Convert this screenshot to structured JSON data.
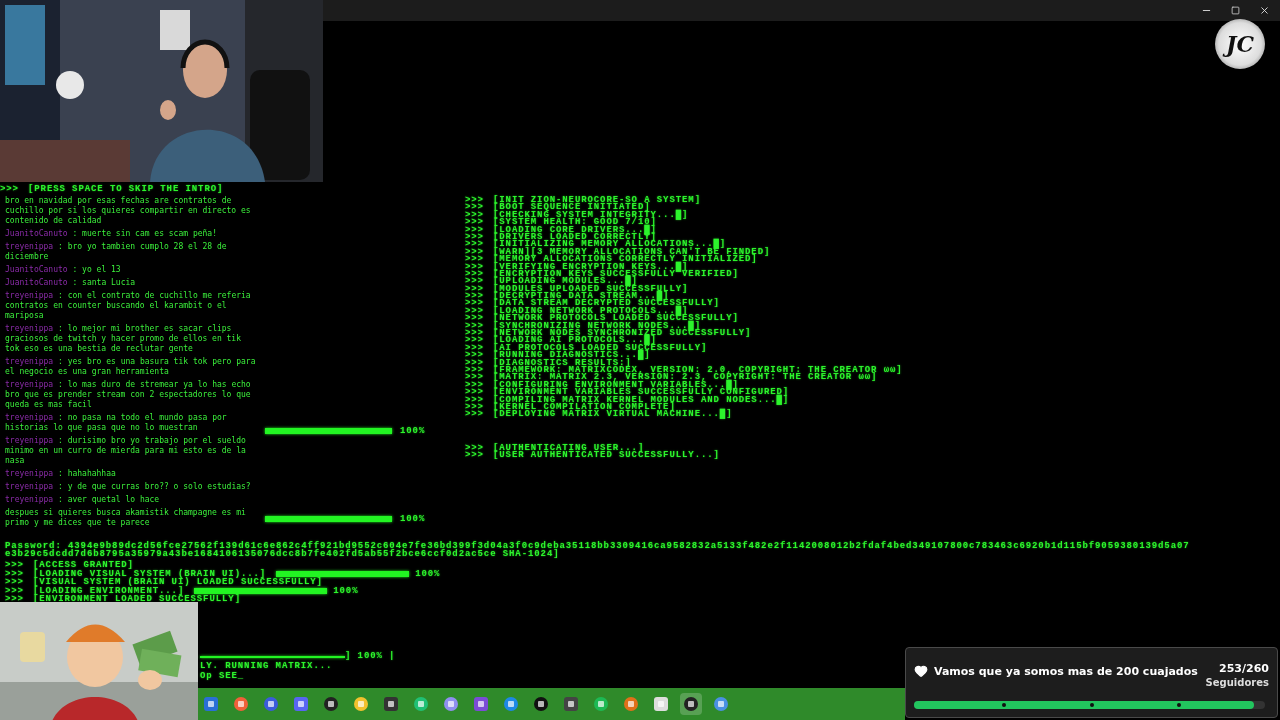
{
  "channel_logo": "JC",
  "terminal": {
    "intro_hint": {
      "prompt": ">>>",
      "text": "[PRESS SPACE TO SKIP THE INTRO]"
    },
    "side_progress": [
      {
        "level": 1,
        "percent": "100%"
      },
      {
        "level": 1,
        "percent": "100%"
      }
    ],
    "boot_log": [
      {
        "prompt": ">>>",
        "text": "[INIT ZION-NEUROCORE-SO A SYSTEM]"
      },
      {
        "prompt": ">>>",
        "text": "[BOOT SEQUENCE INITIATED]"
      },
      {
        "prompt": ">>>",
        "text": "[CHECKING SYSTEM INTEGRITY...█]"
      },
      {
        "prompt": ">>>",
        "text": "[SYSTEM HEALTH: GOOD 7/10]"
      },
      {
        "prompt": ">>>",
        "text": "[LOADING CORE DRIVERS...█]"
      },
      {
        "prompt": ">>>",
        "text": "[DRIVERS LOADED CORRECTLY]"
      },
      {
        "prompt": ">>>",
        "text": "[INITIALIZING MEMORY ALLOCATIONS...█]"
      },
      {
        "prompt": ">>>",
        "text": "[WARN][3 MEMORY ALLOCATIONS CAN'T BE FINDED]"
      },
      {
        "prompt": ">>>",
        "text": "[MEMORY ALLOCATIONS CORRECTLY INITIALIZED]"
      },
      {
        "prompt": ">>>",
        "text": "[VERIFYING ENCRYPTION KEYS...█]"
      },
      {
        "prompt": ">>>",
        "text": "[ENCRYPTION KEYS SUCCESSFULLY VERIFIED]"
      },
      {
        "prompt": ">>>",
        "text": "[UPLOADING MODULES...█]"
      },
      {
        "prompt": ">>>",
        "text": "[MODULES UPLOADED SUCCESSFULLY]"
      },
      {
        "prompt": ">>>",
        "text": "[DECRYPTING DATA STREAM...█]"
      },
      {
        "prompt": ">>>",
        "text": "[DATA STREAM DECRYPTED SUCCESSFULLY]"
      },
      {
        "prompt": ">>>",
        "text": "[LOADING NETWORK PROTOCOLS...█]"
      },
      {
        "prompt": ">>>",
        "text": "[NETWORK PROTOCOLS LOADED SUCCESSFULLY]"
      },
      {
        "prompt": ">>>",
        "text": "[SYNCHRONIZING NETWORK NODES...█]"
      },
      {
        "prompt": ">>>",
        "text": "[NETWORK NODES SYNCHRONIZED SUCCESSFULLY]"
      },
      {
        "prompt": ">>>",
        "text": "[LOADING AI PROTOCOLS...█]"
      },
      {
        "prompt": ">>>",
        "text": "[AI PROTOCOLS LOADED SUCCESSFULLY]"
      },
      {
        "prompt": ">>>",
        "text": "[RUNNING DIAGNOSTICS...█]"
      },
      {
        "prompt": ">>>",
        "text": "[DIAGNOSTICS RESULTS:]"
      },
      {
        "prompt": ">>>",
        "text": "[FRAMEWORK: MATRIXCODEX, VERSION: 2.0, COPYRIGHT: THE CREATOR ωω]"
      },
      {
        "prompt": ">>>",
        "text": "[MATRIX: MATRIX 2.3, VERSION: 2.3, COPYRIGHT: THE CREATOR ωω]"
      },
      {
        "prompt": ">>>",
        "text": "[CONFIGURING ENVIRONMENT VARIABLES...█]"
      },
      {
        "prompt": ">>>",
        "text": "[ENVIRONMENT VARIABLES SUCCESSFULLY CONFIGURED]"
      },
      {
        "prompt": ">>>",
        "text": "[COMPILING MATRIX KERNEL MODULES AND NODES...█]"
      },
      {
        "prompt": ">>>",
        "text": "[KERNEL COMPILATION COMPLETE]"
      },
      {
        "prompt": ">>>",
        "text": "[DEPLOYING MATRIX VIRTUAL MACHINE...█]"
      }
    ],
    "auth_log": [
      {
        "prompt": ">>>",
        "text": "[AUTHENTICATING USER...]"
      },
      {
        "prompt": ">>>",
        "text": "[USER AUTHENTICATED SUCCESSFULLY...]"
      }
    ],
    "credentials": [
      "Password: 4394e9b89dc2d56fce27562f139d61c6e862c4ff921bd9552c604e7fe36bd399f3d04a3f0c9deba35118bb3309416ca9582832a5133f482e2f1142008012b2fdaf4bed349107800c783463c6920b1d115bf9059380139d5a07",
      "e3b29c5dcdd7d6b8795a35979a43be1684106135076dcc8b7fe402fd5ab55f2bce6ccf0d2ac5ce SHA-1024]"
    ],
    "access_log": [
      {
        "prompt": ">>>",
        "text": "[ACCESS GRANTED]"
      },
      {
        "prompt": ">>>",
        "text": "[LOADING VISUAL SYSTEM (BRAIN UI)...]",
        "level": 1,
        "percent": "100%"
      },
      {
        "prompt": ">>>",
        "text": "[VISUAL SYSTEM (BRAIN UI) LOADED SUCCESSFULLY]"
      },
      {
        "prompt": ">>>",
        "text": "[LOADING ENVIRONMENT...]",
        "level": 1,
        "percent": "100%"
      },
      {
        "prompt": ">>>",
        "text": "[ENVIRONMENT LOADED SUCCESSFULLY]"
      }
    ],
    "tail": [
      {
        "level": 1,
        "text": "] 100% |"
      },
      {
        "text": "LY. RUNNING MATRIX..."
      },
      {
        "text": "Op SEE_"
      }
    ]
  },
  "chat": [
    {
      "message": "bro en navidad por esas fechas are contratos de cuchillo por si los quieres compartir en directo es contenido de calidad"
    },
    {
      "user": "JuanitoCanuto",
      "sep": ":",
      "message": "muerte sin cam es scam peña!"
    },
    {
      "user": "treyenippa",
      "sep": ":",
      "message": "bro yo tambien cumplo 28 el 28 de diciembre"
    },
    {
      "user": "JuanitoCanuto",
      "sep": ":",
      "message": "yo el 13"
    },
    {
      "user": "JuanitoCanuto",
      "sep": ":",
      "message": "santa Lucia"
    },
    {
      "user": "treyenippa",
      "sep": ":",
      "message": "con el contrato de cuchillo me referia contratos en counter buscando el karambit o el mariposa"
    },
    {
      "user": "treyenippa",
      "sep": ":",
      "message": "lo mejor mi brother es sacar clips graciosos de twitch y hacer promo de ellos en tik tok eso es una bestia de reclutar gente"
    },
    {
      "user": "treyenippa",
      "sep": ":",
      "message": "yes bro es una basura tik tok pero para el negocio es una gran herramienta"
    },
    {
      "user": "treyenippa",
      "sep": ":",
      "message": "lo mas duro de stremear ya lo has echo bro que es prender stream con 2 espectadores lo que queda es mas facil"
    },
    {
      "user": "treyenippa",
      "sep": ":",
      "message": "no pasa na todo el mundo pasa por historias lo que pasa que no lo muestran"
    },
    {
      "user": "treyenippa",
      "sep": ":",
      "message": "durisimo bro yo trabajo por el sueldo minimo en un curro de mierda para mi esto es de la nasa"
    },
    {
      "user": "treyenippa",
      "sep": ":",
      "message": "hahahahhaa"
    },
    {
      "user": "treyenippa",
      "sep": ":",
      "message": "y de que curras bro?? o solo estudias?"
    },
    {
      "user": "treyenippa",
      "sep": ":",
      "message": "aver quetal lo hace"
    },
    {
      "message": "despues si quieres busca akamistik champagne es mi primo y me dices que te parece"
    }
  ],
  "follower_goal": {
    "title": "Vamos que ya somos mas de 200 cuajados",
    "count": "253/260",
    "label": "Seguidores",
    "level": 0.97
  }
}
